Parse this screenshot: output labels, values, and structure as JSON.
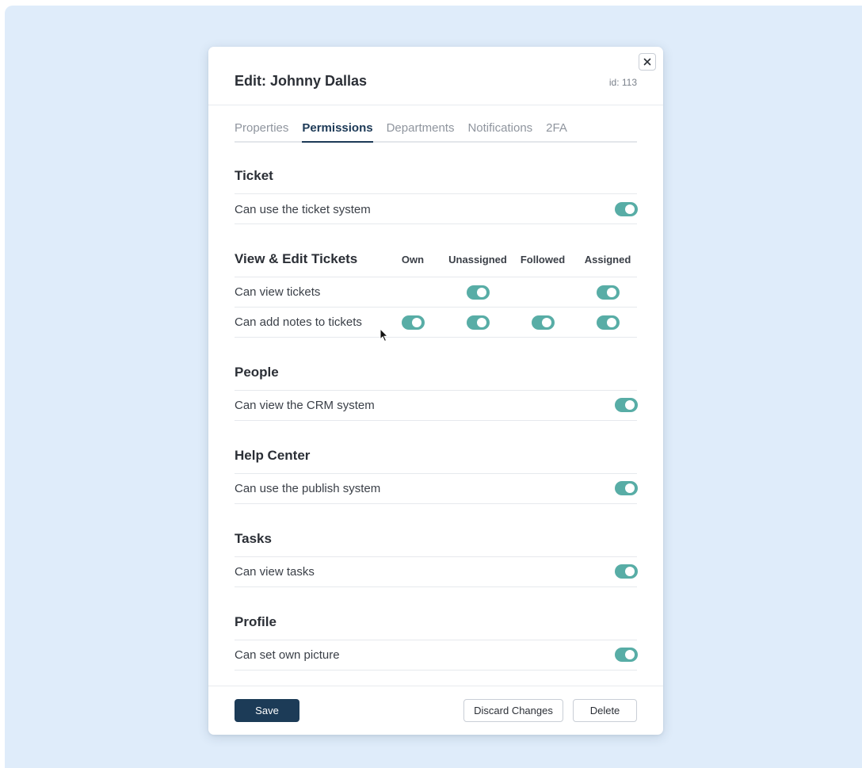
{
  "modal": {
    "title": "Edit: Johnny Dallas",
    "id_text": "id: 113",
    "close_icon": "close-icon"
  },
  "tabs": [
    {
      "label": "Properties",
      "active": false
    },
    {
      "label": "Permissions",
      "active": true
    },
    {
      "label": "Departments",
      "active": false
    },
    {
      "label": "Notifications",
      "active": false
    },
    {
      "label": "2FA",
      "active": false
    }
  ],
  "ticket": {
    "title": "Ticket",
    "rows": [
      {
        "label": "Can use the ticket system",
        "enabled": true
      }
    ]
  },
  "view_edit": {
    "title": "View & Edit Tickets",
    "columns": [
      "Own",
      "Unassigned",
      "Followed",
      "Assigned"
    ],
    "rows": [
      {
        "label": "Can view tickets",
        "own": null,
        "unassigned": true,
        "followed": null,
        "assigned": true
      },
      {
        "label": "Can add notes to tickets",
        "own": true,
        "unassigned": true,
        "followed": true,
        "assigned": true
      }
    ]
  },
  "people": {
    "title": "People",
    "rows": [
      {
        "label": "Can view the CRM system",
        "enabled": true
      }
    ]
  },
  "help_center": {
    "title": "Help Center",
    "rows": [
      {
        "label": "Can use the publish system",
        "enabled": true
      }
    ]
  },
  "tasks": {
    "title": "Tasks",
    "rows": [
      {
        "label": "Can view tasks",
        "enabled": true
      }
    ]
  },
  "profile": {
    "title": "Profile",
    "rows": [
      {
        "label": "Can set own picture",
        "enabled": true
      }
    ]
  },
  "footer": {
    "save_label": "Save",
    "discard_label": "Discard Changes",
    "delete_label": "Delete"
  },
  "colors": {
    "background": "#dfecfa",
    "accent": "#58ada6",
    "primary": "#1c3b57"
  }
}
